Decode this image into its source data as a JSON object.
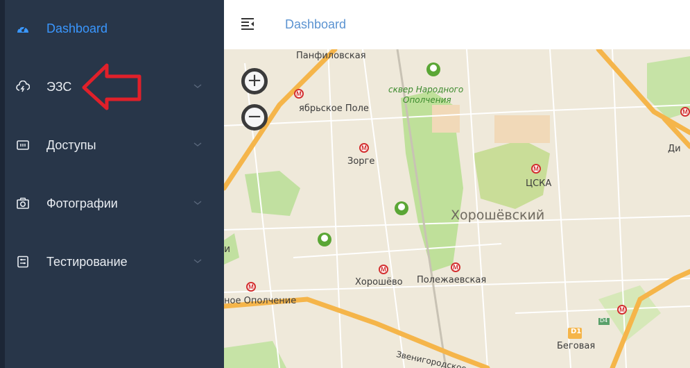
{
  "sidebar": {
    "items": [
      {
        "label": "Dashboard",
        "icon": "dashboard-icon",
        "active": true
      },
      {
        "label": "ЭЗС",
        "icon": "charging-cloud-icon"
      },
      {
        "label": "Доступы",
        "icon": "access-card-icon"
      },
      {
        "label": "Фотографии",
        "icon": "camera-icon"
      },
      {
        "label": "Тестирование",
        "icon": "testing-icon"
      }
    ]
  },
  "header": {
    "title": "Dashboard",
    "menu_icon": "menu-fold-icon"
  },
  "map": {
    "zoom_in": "+",
    "zoom_out": "−",
    "labels": {
      "panfilovskaya": "Панфиловская",
      "oktyabrskoe_pole": "ябрьское Поле",
      "skver_line1": "сквер Народного",
      "skver_line2": "Ополчения",
      "zorge": "Зорге",
      "cska": "ЦСКА",
      "khoroshevsky": "Хорошёвский",
      "khoroshevo": "Хорошёво",
      "polezhaevskaya": "Полежаевская",
      "opolchenie": "ное Ополчение",
      "zvenigorodskoe": "Звенигородское",
      "begovaya": "Беговая",
      "din": "Ди",
      "d1": "D1",
      "d4": "D4",
      "edge_i": "и"
    }
  },
  "colors": {
    "sidebar_bg": "#283649",
    "active": "#3a97ff",
    "annotation_arrow": "#e0202a",
    "metro": "#d32f2f",
    "road": "#f5b54a"
  }
}
